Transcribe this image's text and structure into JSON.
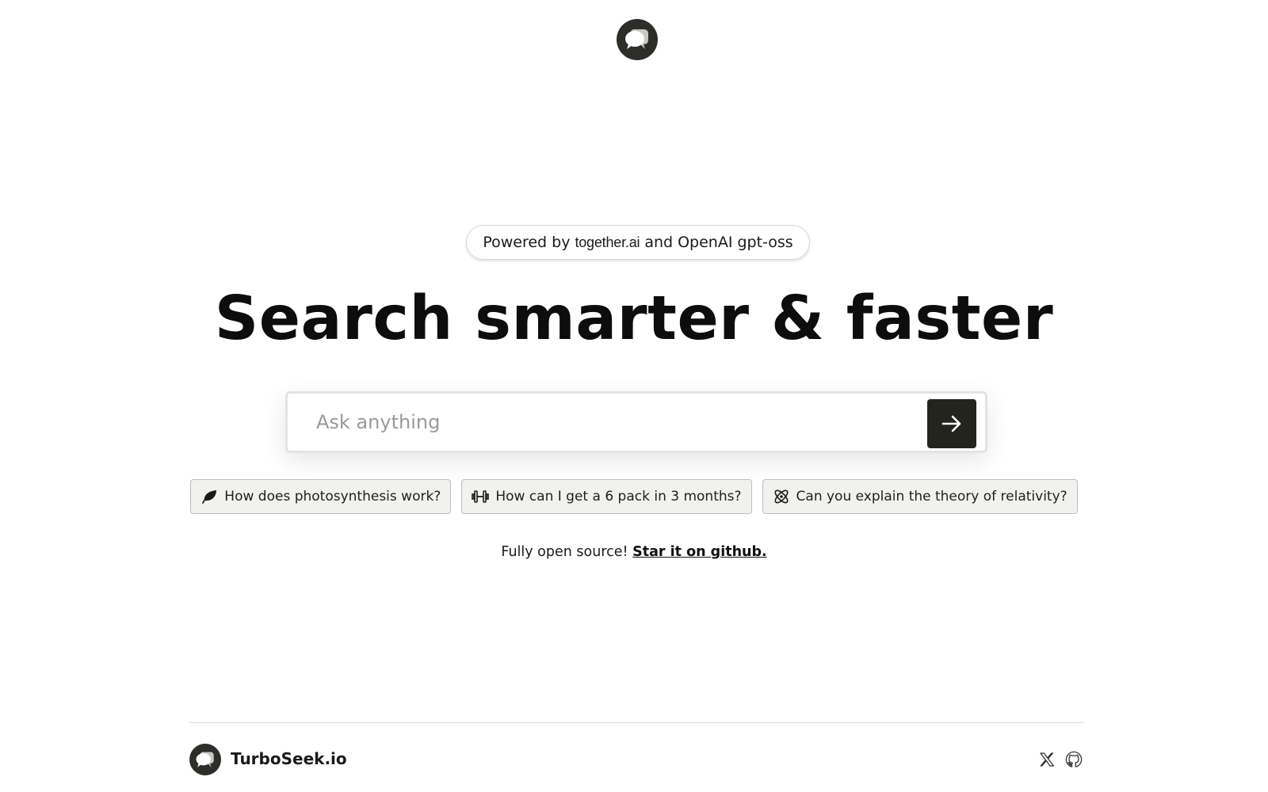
{
  "header": {
    "logo_icon": "chat-bubble-logo-icon"
  },
  "powered": {
    "prefix": "Powered by",
    "brand": "together.ai",
    "suffix": "and OpenAI gpt-oss"
  },
  "hero": {
    "title": "Search smarter & faster"
  },
  "search": {
    "placeholder": "Ask anything",
    "value": "",
    "submit_icon": "arrow-right-icon"
  },
  "suggestions": [
    {
      "icon": "leaf-icon",
      "label": "How does photosynthesis work?"
    },
    {
      "icon": "dumbbell-icon",
      "label": "How can I get a 6 pack in 3 months?"
    },
    {
      "icon": "atom-icon",
      "label": "Can you explain the theory of relativity?"
    }
  ],
  "open_source": {
    "text": "Fully open source!",
    "link": "Star it on github."
  },
  "footer": {
    "brand": "TurboSeek.io",
    "social": [
      "x-icon",
      "github-icon"
    ]
  },
  "colors": {
    "dark": "#24241f",
    "logo_bg": "#2e2e28",
    "chip_bg": "#f1f1ee",
    "border": "#d9d9d9"
  }
}
